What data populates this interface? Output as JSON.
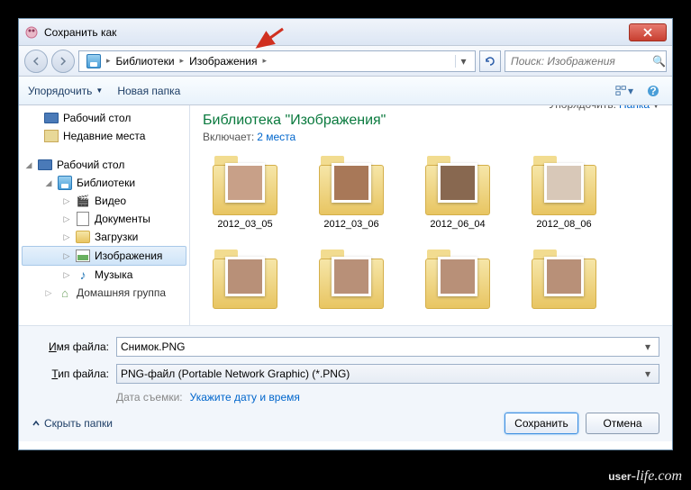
{
  "window": {
    "title": "Сохранить как"
  },
  "address": {
    "segments": [
      "Библиотеки",
      "Изображения"
    ],
    "search_placeholder": "Поиск: Изображения"
  },
  "toolbar": {
    "organize": "Упорядочить",
    "new_folder": "Новая папка"
  },
  "sidebar": {
    "desktop": "Рабочий стол",
    "recent": "Недавние места",
    "desktop2": "Рабочий стол",
    "libraries": "Библиотеки",
    "video": "Видео",
    "documents": "Документы",
    "downloads": "Загрузки",
    "images": "Изображения",
    "music": "Музыка",
    "homegroup": "Домашняя группа"
  },
  "content": {
    "heading": "Библиотека \"Изображения\"",
    "includes_label": "Включает:",
    "includes_link": "2 места",
    "sort_label": "Упорядочить:",
    "sort_value": "Папка",
    "folders": [
      "2012_03_05",
      "2012_03_06",
      "2012_06_04",
      "2012_08_06"
    ]
  },
  "fields": {
    "filename_label": "Имя файла:",
    "filename_value": "Снимок.PNG",
    "filetype_label": "Тип файла:",
    "filetype_value": "PNG-файл (Portable Network Graphic) (*.PNG)",
    "date_label": "Дата съемки:",
    "date_link": "Укажите дату и время"
  },
  "buttons": {
    "hide_folders": "Скрыть папки",
    "save": "Сохранить",
    "cancel": "Отмена"
  },
  "watermark": "user-life.com"
}
